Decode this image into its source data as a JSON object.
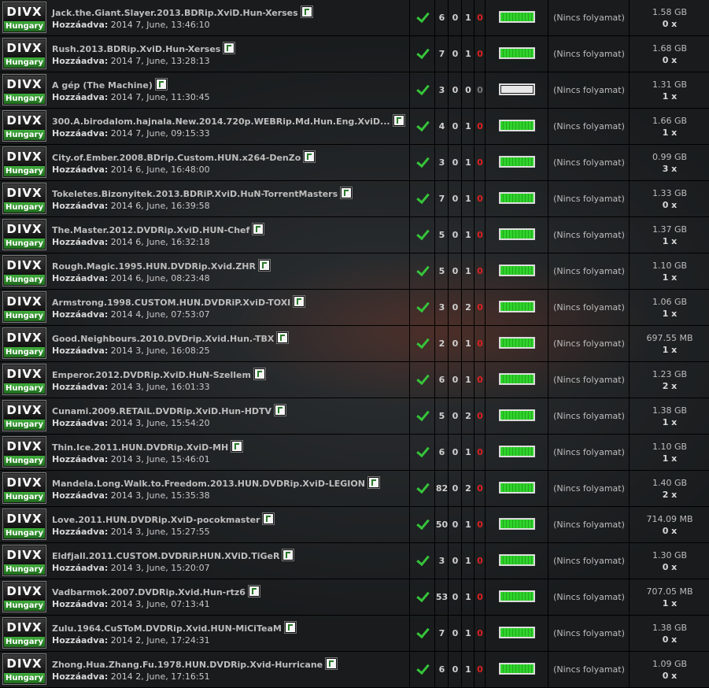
{
  "logo": {
    "top": "DIVX",
    "bottom": "Hungary"
  },
  "added_label": "Hozzáadva:",
  "rows": [
    {
      "title": "Jack.the.Giant.Slayer.2013.BDRip.XviD.Hun-Xerses",
      "added": "2014 7, June, 13:46:10",
      "seeders": "6",
      "leechers": "0",
      "completed": "1",
      "extra": "0",
      "extra_state": "red",
      "progress": 1.0,
      "status": "(Nincs folyamat)",
      "size": "1.58 GB",
      "count": "0 x"
    },
    {
      "title": "Rush.2013.BDRip.XviD.Hun-Xerses",
      "added": "2014 7, June, 13:28:13",
      "seeders": "7",
      "leechers": "0",
      "completed": "1",
      "extra": "0",
      "extra_state": "red",
      "progress": 1.0,
      "status": "(Nincs folyamat)",
      "size": "1.68 GB",
      "count": "0 x"
    },
    {
      "title": "A gép (The Machine)",
      "added": "2014 7, June, 11:30:45",
      "seeders": "3",
      "leechers": "0",
      "completed": "0",
      "extra": "0",
      "extra_state": "grey",
      "progress": 0.0,
      "status": "(Nincs folyamat)",
      "size": "1.31 GB",
      "count": "1 x"
    },
    {
      "title": "300.A.birodalom.hajnala.New.2014.720p.WEBRip.Md.Hun.Eng.XviD...",
      "added": "2014 7, June, 09:15:33",
      "seeders": "4",
      "leechers": "0",
      "completed": "1",
      "extra": "0",
      "extra_state": "red",
      "progress": 1.0,
      "status": "(Nincs folyamat)",
      "size": "1.66 GB",
      "count": "1 x"
    },
    {
      "title": "City.of.Ember.2008.BDrip.Custom.HUN.x264-DenZo",
      "added": "2014 6, June, 16:48:00",
      "seeders": "3",
      "leechers": "0",
      "completed": "1",
      "extra": "0",
      "extra_state": "red",
      "progress": 1.0,
      "status": "(Nincs folyamat)",
      "size": "0.99 GB",
      "count": "3 x"
    },
    {
      "title": "Tokeletes.Bizonyitek.2013.BDRiP.XviD.HuN-TorrentMasters",
      "added": "2014 6, June, 16:39:58",
      "seeders": "7",
      "leechers": "0",
      "completed": "1",
      "extra": "0",
      "extra_state": "red",
      "progress": 1.0,
      "status": "(Nincs folyamat)",
      "size": "1.33 GB",
      "count": "0 x"
    },
    {
      "title": "The.Master.2012.DVDRip.XviD.HUN-Chef",
      "added": "2014 6, June, 16:32:18",
      "seeders": "5",
      "leechers": "0",
      "completed": "1",
      "extra": "0",
      "extra_state": "red",
      "progress": 1.0,
      "status": "(Nincs folyamat)",
      "size": "1.37 GB",
      "count": "1 x"
    },
    {
      "title": "Rough.Magic.1995.HUN.DVDRip.Xvid.ZHR",
      "added": "2014 6, June, 08:23:48",
      "seeders": "5",
      "leechers": "0",
      "completed": "1",
      "extra": "0",
      "extra_state": "red",
      "progress": 1.0,
      "status": "(Nincs folyamat)",
      "size": "1.10 GB",
      "count": "1 x"
    },
    {
      "title": "Armstrong.1998.CUSTOM.HUN.DVDRiP.XviD-TOXI",
      "added": "2014 4, June, 07:53:07",
      "seeders": "3",
      "leechers": "0",
      "completed": "2",
      "extra": "0",
      "extra_state": "red",
      "progress": 1.0,
      "status": "(Nincs folyamat)",
      "size": "1.06 GB",
      "count": "1 x"
    },
    {
      "title": "Good.Neighbours.2010.DVDrip.Xvid.Hun.-TBX",
      "added": "2014 3, June, 16:08:25",
      "seeders": "2",
      "leechers": "0",
      "completed": "1",
      "extra": "0",
      "extra_state": "red",
      "progress": 1.0,
      "status": "(Nincs folyamat)",
      "size": "697.55 MB",
      "count": "1 x"
    },
    {
      "title": "Emperor.2012.DVDRip.XviD.HuN-Szellem",
      "added": "2014 3, June, 16:01:33",
      "seeders": "6",
      "leechers": "0",
      "completed": "1",
      "extra": "0",
      "extra_state": "red",
      "progress": 1.0,
      "status": "(Nincs folyamat)",
      "size": "1.23 GB",
      "count": "2 x"
    },
    {
      "title": "Cunami.2009.RETAiL.DVDRip.XviD.Hun-HDTV",
      "added": "2014 3, June, 15:54:20",
      "seeders": "5",
      "leechers": "0",
      "completed": "2",
      "extra": "0",
      "extra_state": "red",
      "progress": 1.0,
      "status": "(Nincs folyamat)",
      "size": "1.38 GB",
      "count": "1 x"
    },
    {
      "title": "Thin.Ice.2011.HUN.DVDRip.XviD-MH",
      "added": "2014 3, June, 15:46:01",
      "seeders": "6",
      "leechers": "0",
      "completed": "1",
      "extra": "0",
      "extra_state": "red",
      "progress": 1.0,
      "status": "(Nincs folyamat)",
      "size": "1.10 GB",
      "count": "1 x"
    },
    {
      "title": "Mandela.Long.Walk.to.Freedom.2013.HUN.DVDRip.XviD-LEGION",
      "added": "2014 3, June, 15:35:38",
      "seeders": "82",
      "leechers": "0",
      "completed": "2",
      "extra": "0",
      "extra_state": "red",
      "progress": 1.0,
      "status": "(Nincs folyamat)",
      "size": "1.40 GB",
      "count": "2 x"
    },
    {
      "title": "Love.2011.HUN.DVDRip.XviD-pocokmaster",
      "added": "2014 3, June, 15:27:55",
      "seeders": "50",
      "leechers": "0",
      "completed": "1",
      "extra": "0",
      "extra_state": "red",
      "progress": 1.0,
      "status": "(Nincs folyamat)",
      "size": "714.09 MB",
      "count": "0 x"
    },
    {
      "title": "Eldfjall.2011.CUSTOM.DVDRiP.HUN.XViD.TiGeR",
      "added": "2014 3, June, 15:20:07",
      "seeders": "3",
      "leechers": "0",
      "completed": "1",
      "extra": "0",
      "extra_state": "red",
      "progress": 1.0,
      "status": "(Nincs folyamat)",
      "size": "1.30 GB",
      "count": "0 x"
    },
    {
      "title": "Vadbarmok.2007.DVDRip.Xvid.Hun-rtz6",
      "added": "2014 3, June, 07:13:41",
      "seeders": "53",
      "leechers": "0",
      "completed": "1",
      "extra": "0",
      "extra_state": "red",
      "progress": 1.0,
      "status": "(Nincs folyamat)",
      "size": "707.05 MB",
      "count": "1 x"
    },
    {
      "title": "Zulu.1964.CuSToM.DVDRip.Xvid.HUN-MiCiTeaM",
      "added": "2014 2, June, 17:24:31",
      "seeders": "7",
      "leechers": "0",
      "completed": "1",
      "extra": "0",
      "extra_state": "red",
      "progress": 1.0,
      "status": "(Nincs folyamat)",
      "size": "1.38 GB",
      "count": "0 x"
    },
    {
      "title": "Zhong.Hua.Zhang.Fu.1978.HUN.DVDRip.Xvid-Hurricane",
      "added": "2014 2, June, 17:16:51",
      "seeders": "6",
      "leechers": "0",
      "completed": "1",
      "extra": "0",
      "extra_state": "red",
      "progress": 1.0,
      "status": "(Nincs folyamat)",
      "size": "1.09 GB",
      "count": "0 x"
    }
  ]
}
